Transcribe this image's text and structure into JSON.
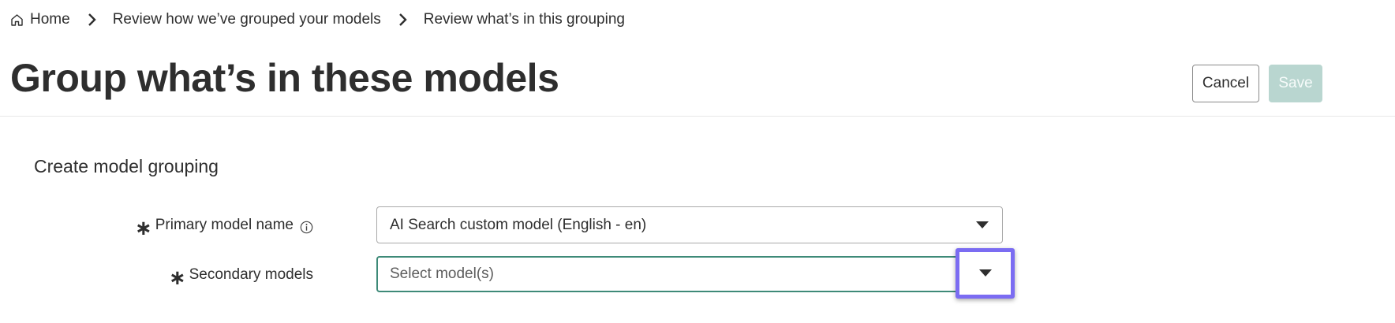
{
  "breadcrumb": {
    "home_icon": "home-icon",
    "items": [
      {
        "label": "Home"
      },
      {
        "label": "Review how we’ve grouped your models"
      },
      {
        "label": "Review what’s in this grouping"
      }
    ],
    "separator_icon": "chevron-right-icon"
  },
  "header": {
    "title": "Group what’s in these models",
    "cancel_label": "Cancel",
    "save_label": "Save"
  },
  "section": {
    "title": "Create model grouping"
  },
  "form": {
    "primary": {
      "required_mark": "∗",
      "label": "Primary model name",
      "info_icon": "info-icon",
      "value": "AI Search custom model (English - en)"
    },
    "secondary": {
      "required_mark": "∗",
      "label": "Secondary models",
      "placeholder": "Select model(s)"
    }
  },
  "colors": {
    "save_disabled_bg": "#b9d6d0",
    "active_border": "#3e8a78",
    "highlight_border": "#7b6cf2"
  }
}
